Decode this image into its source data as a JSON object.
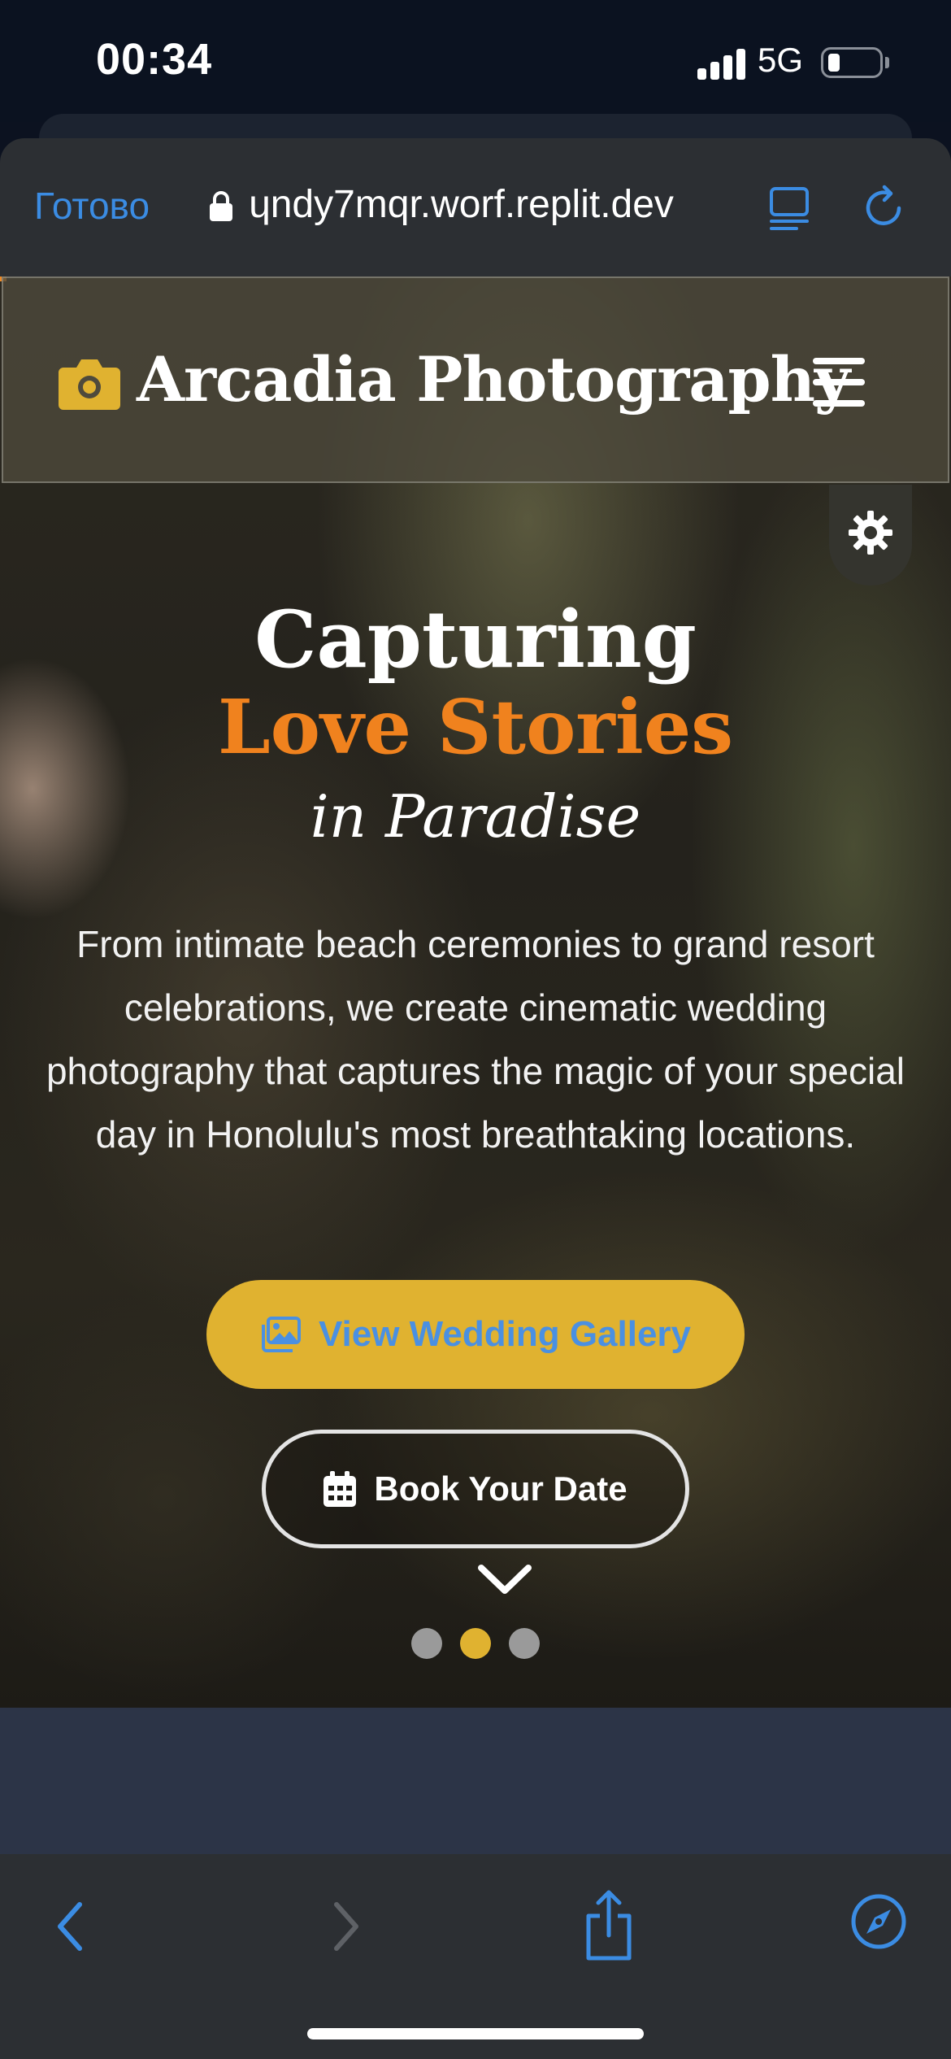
{
  "status_bar": {
    "time": "00:34",
    "network": "5G",
    "signal_icon": "signal-bars-icon",
    "battery_icon": "battery-icon"
  },
  "browser": {
    "done_label": "Готово",
    "url": "ɥndy7mqr.worf.replit.dev",
    "icons": [
      "lock-icon",
      "reader-icon",
      "reload-icon"
    ]
  },
  "site": {
    "brand": "Arcadia Photography",
    "icons": [
      "camera-icon",
      "hamburger-menu-icon",
      "gear-icon"
    ]
  },
  "hero": {
    "title_line1": "Capturing",
    "title_line2": "Love Stories",
    "title_line3": "in Paradise",
    "description": "From intimate beach ceremonies to grand resort celebrations, we create cinematic wedding photography that captures the magic of your special day in Honolulu's most breathtaking locations.",
    "primary_button": "View Wedding Gallery",
    "secondary_button": "Book Your Date",
    "slides_total": 3,
    "active_slide": 2
  },
  "bottom_toolbar": {
    "icons": [
      "back-icon",
      "forward-icon",
      "share-icon",
      "compass-icon"
    ]
  },
  "colors": {
    "accent_gold": "#e0b230",
    "accent_orange": "#f0821e",
    "ios_blue": "#3b8ce3",
    "dot_inactive": "#9a9a9a"
  }
}
